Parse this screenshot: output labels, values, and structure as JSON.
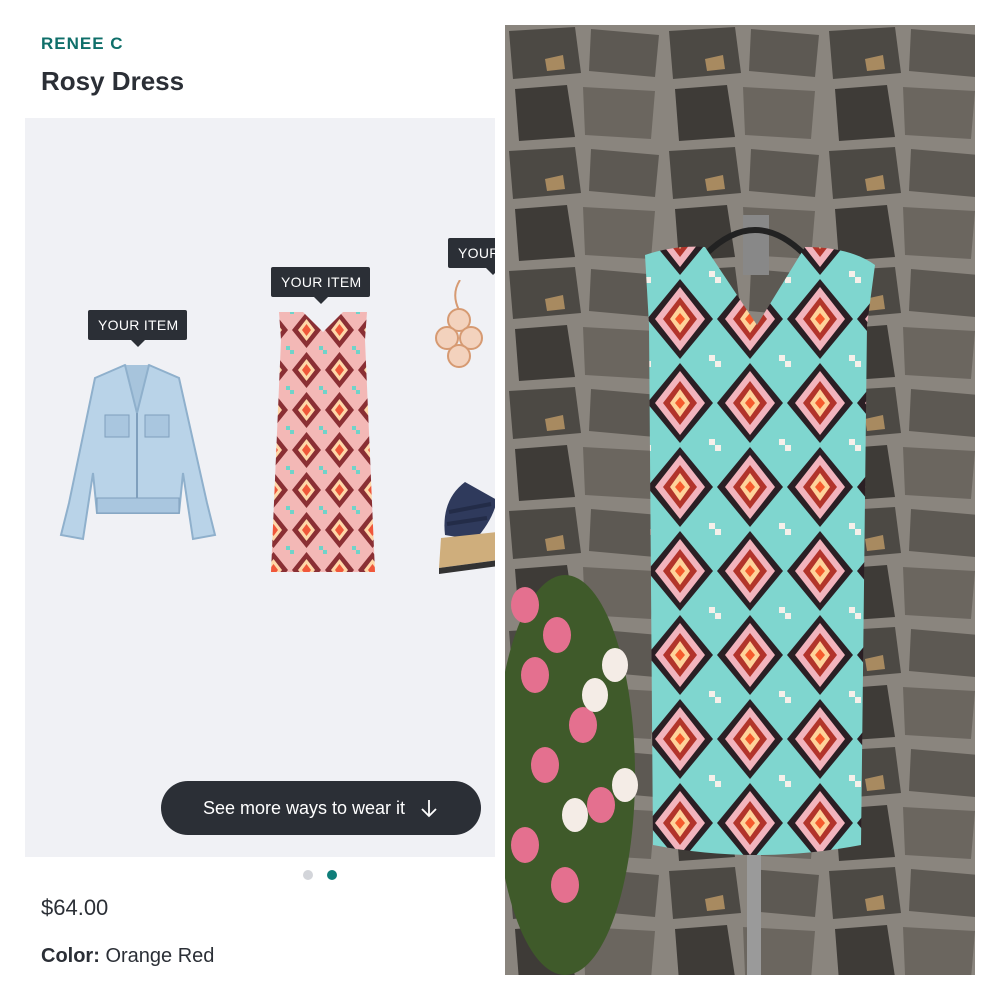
{
  "product": {
    "brand": "RENEE C",
    "title": "Rosy Dress",
    "price": "$64.00",
    "color_label": "Color:",
    "color_value": "Orange Red"
  },
  "outfit": {
    "tags": [
      "YOUR ITEM",
      "YOUR ITEM",
      "YOUR"
    ],
    "items": [
      "denim-jacket",
      "rosy-dress",
      "rose-gold-earrings",
      "navy-wedge-sandal"
    ],
    "more_button": "See more ways to wear it",
    "pager": {
      "pages": 2,
      "active": 2
    }
  },
  "colors": {
    "brand_teal": "#0f6f6a",
    "dark": "#2b2f36",
    "panel_bg": "#f0f1f5",
    "dot_active": "#0f7e7a",
    "dot_inactive": "#d3d5da"
  }
}
